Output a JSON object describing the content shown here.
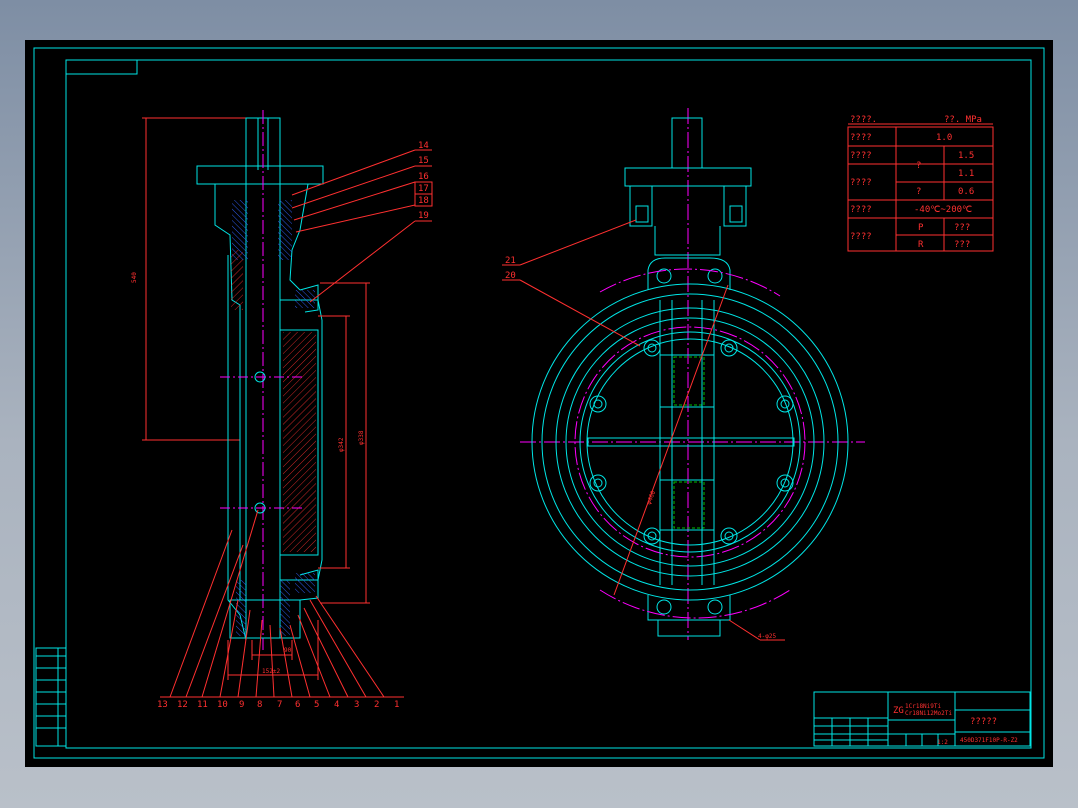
{
  "section_view": {
    "dims": [
      "540",
      "φ342",
      "φ338",
      "90",
      "152±2"
    ],
    "callouts_top": [
      "14",
      "15",
      "16",
      "17",
      "18",
      "19"
    ],
    "callouts_bottom": [
      "13",
      "12",
      "11",
      "10",
      "9",
      "8",
      "7",
      "6",
      "5",
      "4",
      "3",
      "2",
      "1"
    ]
  },
  "front_view": {
    "dims": [
      "φ460",
      "4-φ25"
    ],
    "callouts": [
      "21",
      "20"
    ]
  },
  "spec_table": {
    "title": "????.",
    "pressure_header": "??. MPa",
    "rows": [
      {
        "label": "????",
        "value": "1.0"
      },
      {
        "label": "????",
        "sub": "?",
        "value": "1.5",
        "value2": "1.1"
      },
      {
        "label": "????",
        "sub": "?",
        "value": "0.6"
      },
      {
        "label": "????",
        "value": "-40℃~200℃"
      },
      {
        "label": "????",
        "sub": "P",
        "value": "???",
        "sub2": "R",
        "value2": "???"
      }
    ]
  },
  "title_block": {
    "material_prefix": "ZG",
    "material_line1": "1Cr18Ni9Ti",
    "material_line2": "Cr18Ni12Mo2Ti",
    "name": "?????",
    "number": "450D371F10P-R-Z2",
    "scale": "1:2"
  },
  "colors": {
    "outline": "#00e5e5",
    "annotation": "#ff3030",
    "centerline": "#ff00ff",
    "hatch_blue": "#3060ff",
    "hidden_green": "#00c000",
    "background": "#000000"
  }
}
